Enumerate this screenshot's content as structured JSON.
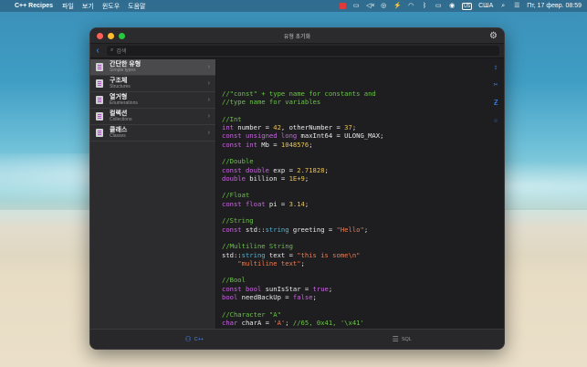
{
  "menubar": {
    "app_name": "C++ Recipes",
    "items": [
      "파일",
      "보기",
      "윈도우",
      "도움말"
    ],
    "lang_badge": "US",
    "lang": "США",
    "datetime": "Пт, 17 февр.  08:59"
  },
  "window": {
    "title": "유형 초기화",
    "search_placeholder": "검색"
  },
  "sidebar": {
    "items": [
      {
        "label": "간단한 유형",
        "sub": "Simple types"
      },
      {
        "label": "구조체",
        "sub": "Structures"
      },
      {
        "label": "열거형",
        "sub": "Enumerations"
      },
      {
        "label": "컬렉션",
        "sub": "Collections"
      },
      {
        "label": "클래스",
        "sub": "Classes"
      }
    ]
  },
  "code_lines": [
    [
      {
        "t": "//\"const\" + type name for constants and",
        "c": "comment"
      }
    ],
    [
      {
        "t": "//type name for variables",
        "c": "comment"
      }
    ],
    [],
    [
      {
        "t": "//Int",
        "c": "comment"
      }
    ],
    [
      {
        "t": "int",
        "c": "kw"
      },
      {
        "t": " number = ",
        "c": "plain"
      },
      {
        "t": "42",
        "c": "num"
      },
      {
        "t": ", otherNumber = ",
        "c": "plain"
      },
      {
        "t": "37",
        "c": "num"
      },
      {
        "t": ";",
        "c": "plain"
      }
    ],
    [
      {
        "t": "const unsigned long",
        "c": "kw"
      },
      {
        "t": " maxInt64 = ULONG_MAX;",
        "c": "plain"
      }
    ],
    [
      {
        "t": "const int",
        "c": "kw"
      },
      {
        "t": " Mb = ",
        "c": "plain"
      },
      {
        "t": "1048576",
        "c": "num"
      },
      {
        "t": ";",
        "c": "plain"
      }
    ],
    [],
    [
      {
        "t": "//Double",
        "c": "comment"
      }
    ],
    [
      {
        "t": "const double",
        "c": "kw"
      },
      {
        "t": " exp = ",
        "c": "plain"
      },
      {
        "t": "2.71828",
        "c": "num"
      },
      {
        "t": ";",
        "c": "plain"
      }
    ],
    [
      {
        "t": "double",
        "c": "kw"
      },
      {
        "t": " billion = ",
        "c": "plain"
      },
      {
        "t": "1E+9",
        "c": "num"
      },
      {
        "t": ";",
        "c": "plain"
      }
    ],
    [],
    [
      {
        "t": "//Float",
        "c": "comment"
      }
    ],
    [
      {
        "t": "const float",
        "c": "kw"
      },
      {
        "t": " pi = ",
        "c": "plain"
      },
      {
        "t": "3.14",
        "c": "num"
      },
      {
        "t": ";",
        "c": "plain"
      }
    ],
    [],
    [
      {
        "t": "//String",
        "c": "comment"
      }
    ],
    [
      {
        "t": "const",
        "c": "kw"
      },
      {
        "t": " std::",
        "c": "plain"
      },
      {
        "t": "string",
        "c": "type"
      },
      {
        "t": " greeting = ",
        "c": "plain"
      },
      {
        "t": "\"Hello\"",
        "c": "str"
      },
      {
        "t": ";",
        "c": "plain"
      }
    ],
    [],
    [
      {
        "t": "//Multiline String",
        "c": "comment"
      }
    ],
    [
      {
        "t": "std::",
        "c": "plain"
      },
      {
        "t": "string",
        "c": "type"
      },
      {
        "t": " text = ",
        "c": "plain"
      },
      {
        "t": "\"this is some\\n\"",
        "c": "str"
      }
    ],
    [
      {
        "t": "    \"multiline text\"",
        "c": "str"
      },
      {
        "t": ";",
        "c": "plain"
      }
    ],
    [],
    [
      {
        "t": "//Bool",
        "c": "comment"
      }
    ],
    [
      {
        "t": "const bool",
        "c": "kw"
      },
      {
        "t": " sunIsStar = ",
        "c": "plain"
      },
      {
        "t": "true",
        "c": "kw"
      },
      {
        "t": ";",
        "c": "plain"
      }
    ],
    [
      {
        "t": "bool",
        "c": "kw"
      },
      {
        "t": " needBackUp = ",
        "c": "plain"
      },
      {
        "t": "false",
        "c": "kw"
      },
      {
        "t": ";",
        "c": "plain"
      }
    ],
    [],
    [
      {
        "t": "//Character \"A\"",
        "c": "comment"
      }
    ],
    [
      {
        "t": "char",
        "c": "kw"
      },
      {
        "t": " charA = ",
        "c": "plain"
      },
      {
        "t": "'A'",
        "c": "str"
      },
      {
        "t": "; ",
        "c": "plain"
      },
      {
        "t": "//65, 0x41, '\\x41'",
        "c": "comment"
      }
    ]
  ],
  "tabs": [
    {
      "label": "C++",
      "icon": "cpp-icon",
      "active": true
    },
    {
      "label": "SQL",
      "icon": "database-icon",
      "active": false
    }
  ],
  "colors": {
    "accent": "#3d8dff",
    "comment": "#6cc24a",
    "keyword": "#c866e0",
    "string": "#f07a4e",
    "number": "#e6c15a"
  }
}
